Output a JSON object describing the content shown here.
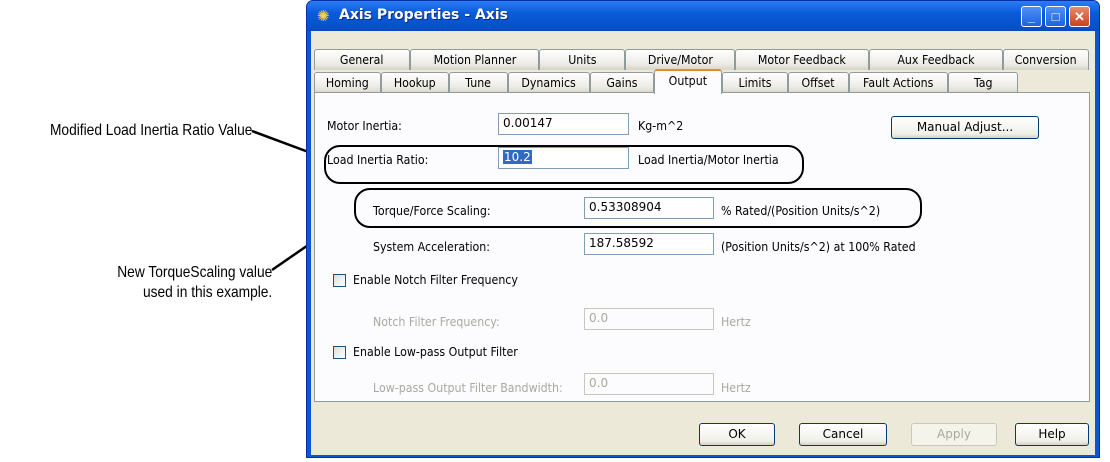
{
  "callouts": {
    "load_inertia": "Modified Load Inertia Ratio Value",
    "torque_line1": "New TorqueScaling value",
    "torque_line2": "used in this example."
  },
  "window": {
    "title": "Axis Properties - Axis",
    "minimize": "_",
    "maximize": "□",
    "close": "✕"
  },
  "tabs_row1": [
    "General",
    "Motion Planner",
    "Units",
    "Drive/Motor",
    "Motor Feedback",
    "Aux Feedback",
    "Conversion"
  ],
  "tabs_row2": [
    "Homing",
    "Hookup",
    "Tune",
    "Dynamics",
    "Gains",
    "Output",
    "Limits",
    "Offset",
    "Fault Actions",
    "Tag"
  ],
  "active_tab": "Output",
  "fields": {
    "motor_inertia": {
      "label": "Motor Inertia:",
      "value": "0.00147",
      "unit": "Kg-m^2"
    },
    "load_inertia": {
      "label": "Load Inertia Ratio:",
      "value": "10.2",
      "unit": "Load Inertia/Motor Inertia"
    },
    "torque_scaling": {
      "label": "Torque/Force Scaling:",
      "value": "0.53308904",
      "unit": "% Rated/(Position Units/s^2)"
    },
    "system_accel": {
      "label": "System Acceleration:",
      "value": "187.58592",
      "unit": "(Position Units/s^2) at 100% Rated"
    },
    "notch_freq": {
      "label": "Notch Filter Frequency:",
      "value": "0.0",
      "unit": "Hertz"
    },
    "lowpass_bw": {
      "label": "Low-pass Output Filter Bandwidth:",
      "value": "0.0",
      "unit": "Hertz"
    }
  },
  "checkboxes": {
    "notch": {
      "label": "Enable Notch Filter Frequency",
      "checked": false
    },
    "lowpass": {
      "label": "Enable Low-pass Output Filter",
      "checked": false
    }
  },
  "buttons": {
    "manual_adjust": "Manual Adjust...",
    "ok": "OK",
    "cancel": "Cancel",
    "apply": "Apply",
    "help": "Help"
  }
}
